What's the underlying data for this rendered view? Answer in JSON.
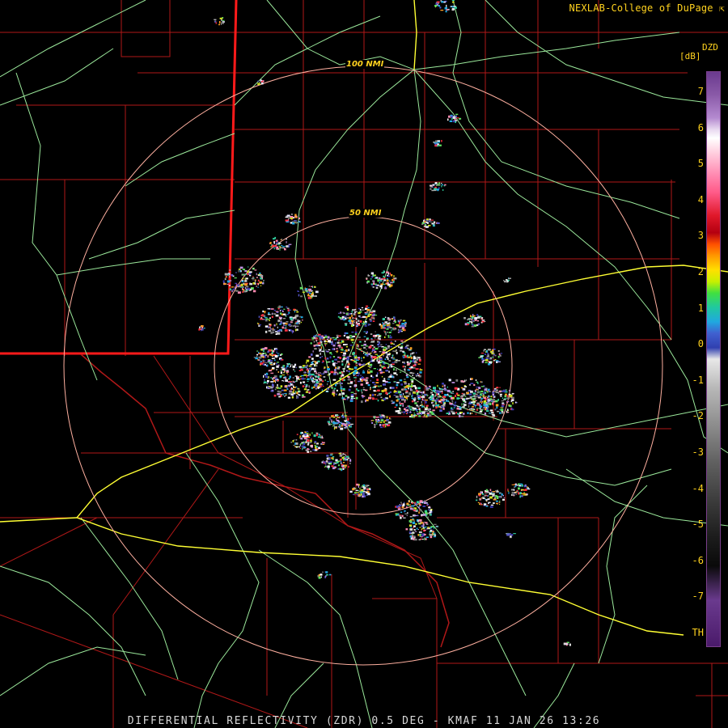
{
  "header": {
    "credit": "NEXLAB-College of DuPage"
  },
  "legend": {
    "product_code": "DZD",
    "unit": "[dB]",
    "ticks": [
      "7",
      "6",
      "5",
      "4",
      "3",
      "2",
      "1",
      "0",
      "-1",
      "-2",
      "-3",
      "-4",
      "-5",
      "-6",
      "-7",
      "TH"
    ]
  },
  "range_rings": [
    {
      "label": "50 NMI"
    },
    {
      "label": "100 NMI"
    }
  ],
  "footer": {
    "caption": "DIFFERENTIAL REFLECTIVITY (ZDR) 0.5 DEG - KMAF 11 JAN 26 13:26"
  },
  "colors": {
    "background": "#000000",
    "county_lines": "#b01818",
    "state_border": "#ff1a1a",
    "highways": "#9be89b",
    "interstates": "#ffff33",
    "range_rings": "#ffb0a0",
    "text": "#ffd21e"
  }
}
